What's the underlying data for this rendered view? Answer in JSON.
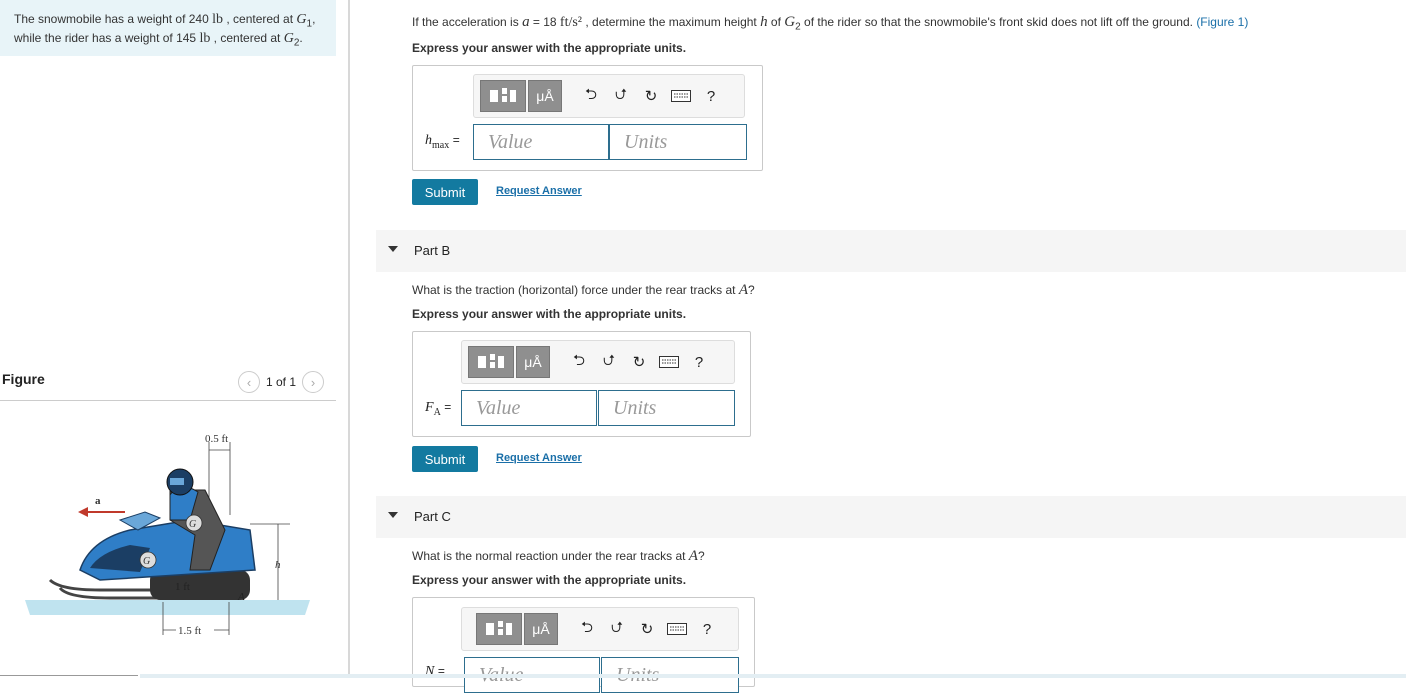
{
  "problem": {
    "line1_pre": "The snowmobile has a weight of 240 ",
    "unit_lb": "lb",
    "line1_mid": " , centered at ",
    "g1": "G",
    "g1_sub": "1",
    "line1_end": ",",
    "line2_pre": "while the rider has a weight of 145 ",
    "line2_mid": " , centered at ",
    "g2_sub": "2",
    "line2_end": "."
  },
  "figure": {
    "label": "Figure",
    "pager": "1 of 1",
    "dim_top": "0.5 ft",
    "dim_bottom": "1.5 ft",
    "dim_1ft": "1 ft",
    "label_a": "a",
    "label_h": "h",
    "label_A": "A",
    "label_G1": "G",
    "label_G2": "G"
  },
  "partA": {
    "q_pre": "If the acceleration is ",
    "q_a": "a",
    "q_eq": " = 18 ",
    "q_unit": "ft/s²",
    "q_mid": " , determine the maximum height ",
    "q_h": "h",
    "q_of": " of ",
    "q_g": "G",
    "q_g_sub": "2",
    "q_end": " of the rider so that the snowmobile's front skid does not lift off the ground. ",
    "q_link": "(Figure 1)",
    "express": "Express your answer with the appropriate units.",
    "var": "h",
    "var_sub": "max",
    "eq": "=",
    "value_placeholder": "Value",
    "units_placeholder": "Units",
    "submit": "Submit",
    "request": "Request Answer"
  },
  "partB": {
    "title": "Part B",
    "q_pre": "What is the traction (horizontal) force under the rear tracks at ",
    "q_A": "A",
    "q_end": "?",
    "express": "Express your answer with the appropriate units.",
    "var": "F",
    "var_sub": "A",
    "eq": "=",
    "value_placeholder": "Value",
    "units_placeholder": "Units",
    "submit": "Submit",
    "request": "Request Answer"
  },
  "partC": {
    "title": "Part C",
    "q_pre": "What is the normal reaction under the rear tracks at ",
    "q_A": "A",
    "q_end": "?",
    "express": "Express your answer with the appropriate units.",
    "var": "N",
    "eq": "=",
    "value_placeholder": "Value",
    "units_placeholder": "Units"
  },
  "toolbar": {
    "mu": "μÅ",
    "help": "?"
  }
}
